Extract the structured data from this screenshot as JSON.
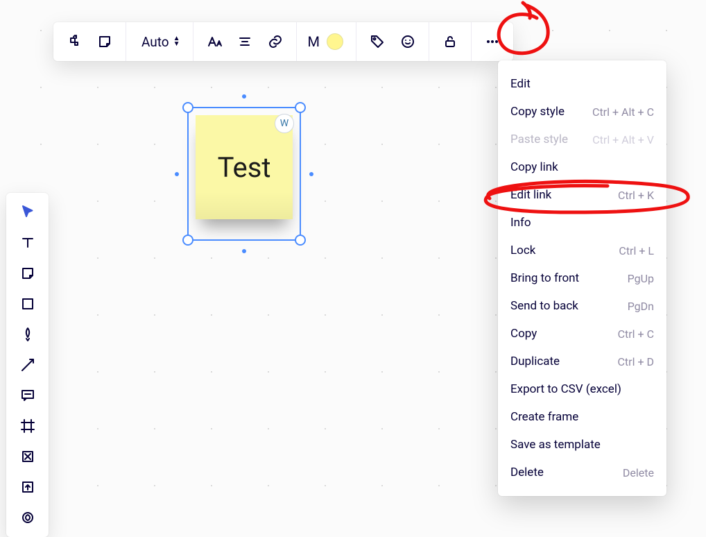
{
  "toolbar": {
    "auto_label": "Auto",
    "size_label": "M"
  },
  "sticky": {
    "text": "Test",
    "badge": "W"
  },
  "menu": {
    "items": [
      {
        "label": "Edit",
        "shortcut": "",
        "disabled": false
      },
      {
        "label": "Copy style",
        "shortcut": "Ctrl + Alt + C",
        "disabled": false
      },
      {
        "label": "Paste style",
        "shortcut": "Ctrl + Alt + V",
        "disabled": true
      },
      {
        "label": "Copy link",
        "shortcut": "",
        "disabled": false
      },
      {
        "label": "Edit link",
        "shortcut": "Ctrl + K",
        "disabled": false
      },
      {
        "label": "Info",
        "shortcut": "",
        "disabled": false
      },
      {
        "label": "Lock",
        "shortcut": "Ctrl + L",
        "disabled": false
      },
      {
        "label": "Bring to front",
        "shortcut": "PgUp",
        "disabled": false
      },
      {
        "label": "Send to back",
        "shortcut": "PgDn",
        "disabled": false
      },
      {
        "label": "Copy",
        "shortcut": "Ctrl + C",
        "disabled": false
      },
      {
        "label": "Duplicate",
        "shortcut": "Ctrl + D",
        "disabled": false
      },
      {
        "label": "Export to CSV (excel)",
        "shortcut": "",
        "disabled": false
      },
      {
        "label": "Create frame",
        "shortcut": "",
        "disabled": false
      },
      {
        "label": "Save as template",
        "shortcut": "",
        "disabled": false
      },
      {
        "label": "Delete",
        "shortcut": "Delete",
        "disabled": false
      }
    ]
  }
}
